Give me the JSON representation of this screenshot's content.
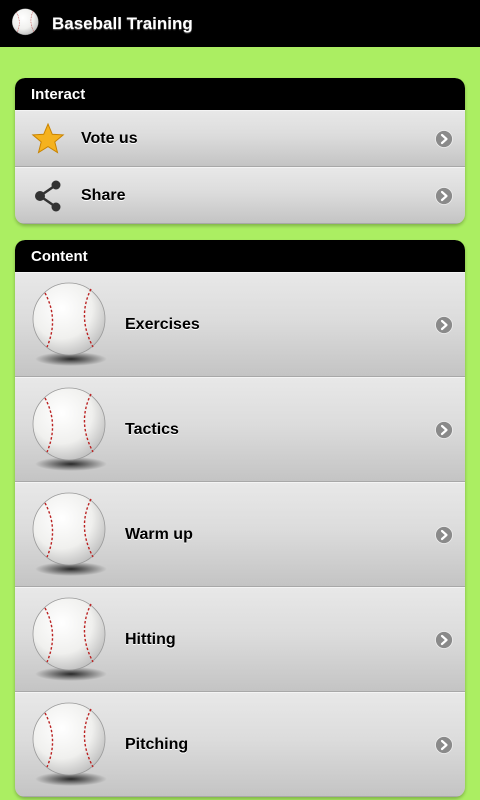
{
  "app": {
    "title": "Baseball Training"
  },
  "interact": {
    "header": "Interact",
    "items": [
      {
        "label": "Vote us",
        "icon": "star-icon"
      },
      {
        "label": "Share",
        "icon": "share-icon"
      }
    ]
  },
  "content": {
    "header": "Content",
    "items": [
      {
        "label": "Exercises",
        "icon": "baseball-icon"
      },
      {
        "label": "Tactics",
        "icon": "baseball-icon"
      },
      {
        "label": "Warm up",
        "icon": "baseball-icon"
      },
      {
        "label": "Hitting",
        "icon": "baseball-icon"
      },
      {
        "label": "Pitching",
        "icon": "baseball-icon"
      }
    ]
  },
  "colors": {
    "background": "#abee62",
    "header": "#000000",
    "row": "#dcdcdc",
    "chevron": "#8a8a8a",
    "star": "#f5b21e"
  }
}
